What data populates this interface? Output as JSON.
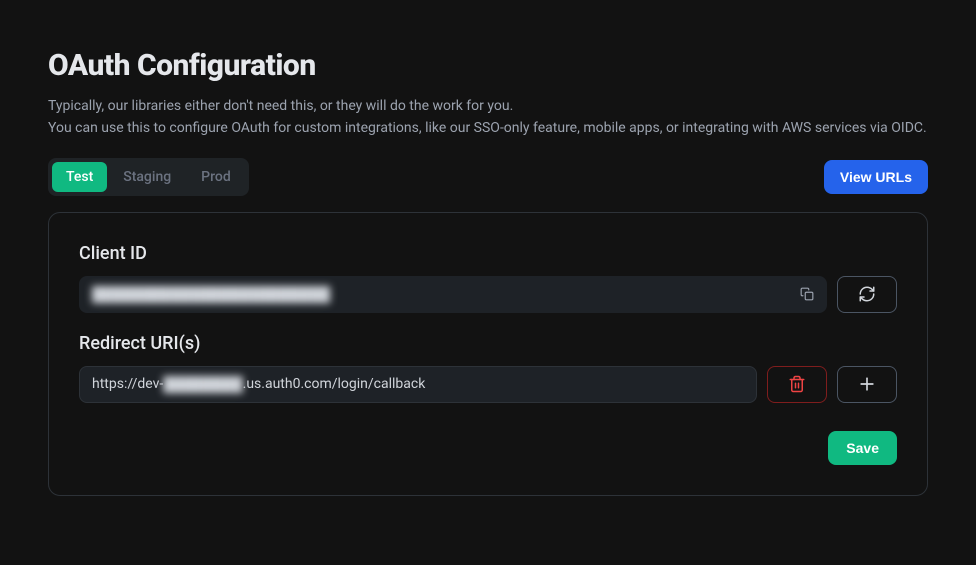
{
  "page": {
    "title": "OAuth Configuration",
    "description_line1": "Typically, our libraries either don't need this, or they will do the work for you.",
    "description_line2": "You can use this to configure OAuth for custom integrations, like our SSO-only feature, mobile apps, or integrating with AWS services via OIDC."
  },
  "tabs": {
    "test": "Test",
    "staging": "Staging",
    "prod": "Prod"
  },
  "buttons": {
    "view_urls": "View URLs",
    "save": "Save"
  },
  "fields": {
    "client_id": {
      "label": "Client ID",
      "value": "████████████████████████"
    },
    "redirect_uris": {
      "label": "Redirect URI(s)",
      "items": [
        {
          "prefix": "https://dev-",
          "redacted": "████████",
          "suffix": ".us.auth0.com/login/callback"
        }
      ]
    }
  }
}
